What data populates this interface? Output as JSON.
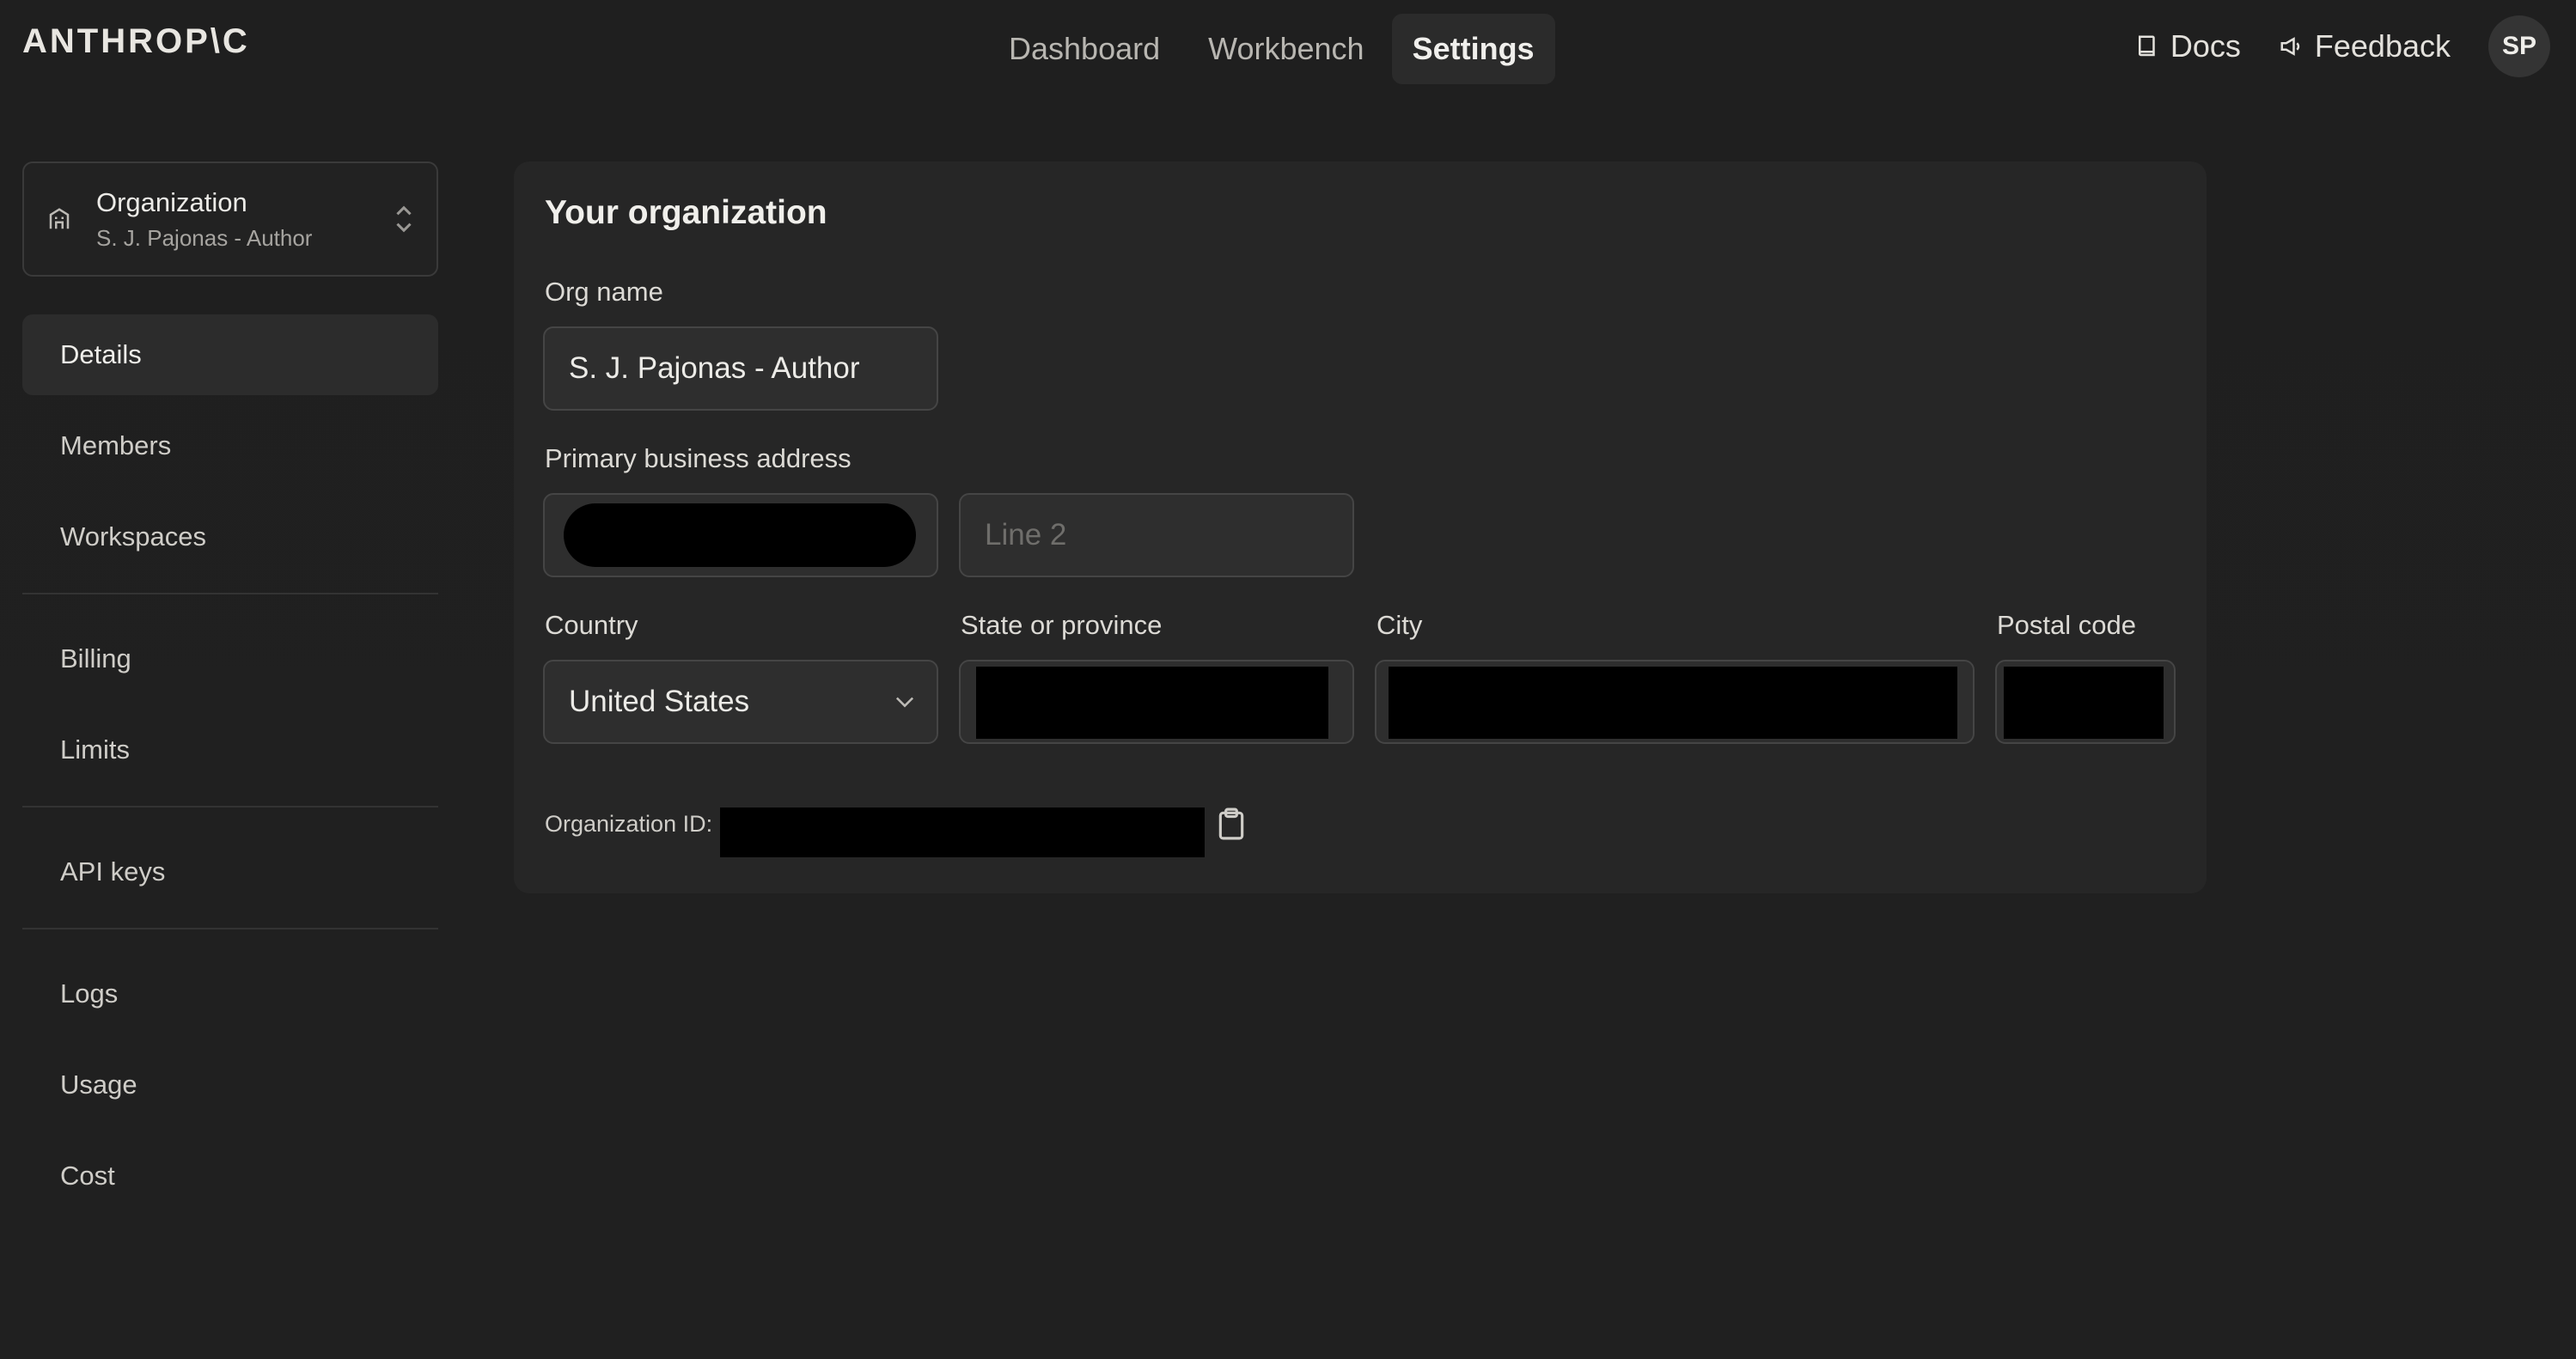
{
  "brand": {
    "logo_text": "ANTHROP\\C"
  },
  "nav": {
    "tabs": [
      {
        "label": "Dashboard",
        "active": false
      },
      {
        "label": "Workbench",
        "active": false
      },
      {
        "label": "Settings",
        "active": true
      }
    ],
    "docs_label": "Docs",
    "feedback_label": "Feedback",
    "avatar_initials": "SP"
  },
  "org_switcher": {
    "title": "Organization",
    "name": "S. J. Pajonas - Author"
  },
  "sidebar": {
    "groups": [
      [
        {
          "label": "Details",
          "active": true
        },
        {
          "label": "Members"
        },
        {
          "label": "Workspaces"
        }
      ],
      [
        {
          "label": "Billing"
        },
        {
          "label": "Limits"
        }
      ],
      [
        {
          "label": "API keys"
        }
      ],
      [
        {
          "label": "Logs"
        },
        {
          "label": "Usage"
        },
        {
          "label": "Cost"
        }
      ]
    ]
  },
  "details": {
    "heading": "Your organization",
    "org_name_label": "Org name",
    "org_name_value": "S. J. Pajonas - Author",
    "address_label": "Primary business address",
    "line2_placeholder": "Line 2",
    "country_label": "Country",
    "country_value": "United States",
    "state_label": "State or province",
    "city_label": "City",
    "postal_label": "Postal code",
    "org_id_label": "Organization ID:"
  },
  "colors": {
    "background": "#1f1f1f",
    "card": "#262626",
    "field": "#2e2e2e",
    "redaction": "#000000"
  }
}
